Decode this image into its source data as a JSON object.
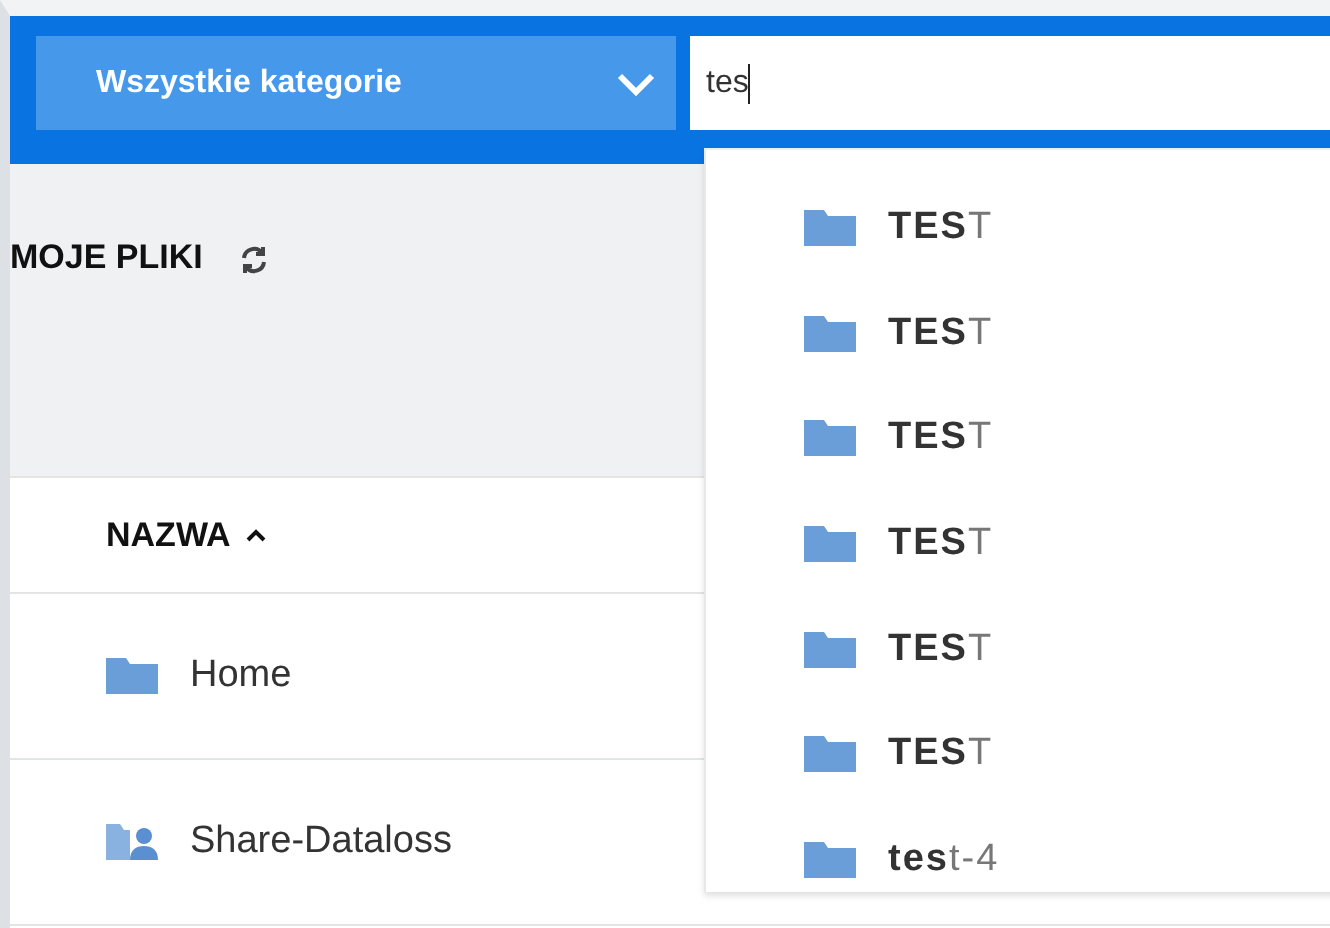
{
  "category_dropdown": {
    "label": "Wszystkie kategorie"
  },
  "search": {
    "value": "tes"
  },
  "section_title": "MOJE PLIKI",
  "table": {
    "columns": [
      {
        "label": "NAZWA",
        "sorted": true
      }
    ],
    "rows": [
      {
        "name": "Home",
        "kind": "folder"
      },
      {
        "name": "Share-Dataloss",
        "kind": "shared"
      }
    ]
  },
  "suggestions": [
    {
      "name": "**TES**T"
    },
    {
      "name": "**TES**T"
    },
    {
      "name": "**TES**T"
    },
    {
      "name": "**TES**T"
    },
    {
      "name": "**TES**T"
    },
    {
      "name": "**TES**T"
    },
    {
      "name": "**tes**t-4"
    }
  ]
}
